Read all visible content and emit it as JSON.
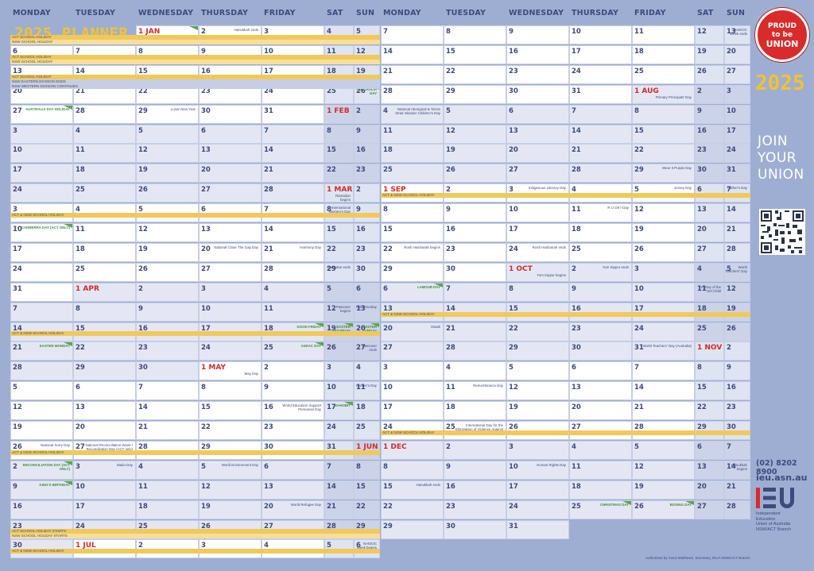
{
  "title": "2025 PLANNER",
  "days_left": [
    "MONDAY",
    "TUESDAY",
    "WEDNESDAY",
    "THURSDAY",
    "FRIDAY",
    "SAT",
    "SUN"
  ],
  "days_right": [
    "MONDAY",
    "TUESDAY",
    "WEDNESDAY",
    "THURSDAY",
    "FRIDAY",
    "SAT",
    "SUN"
  ],
  "months": {
    "1": "JAN",
    "2": "FEB",
    "3": "MAR",
    "4": "APR",
    "5": "MAY",
    "6": "JUN",
    "7": "JUL",
    "8": "AUG",
    "9": "SEP",
    "10": "OCT",
    "11": "NOV",
    "12": "DEC"
  },
  "events": {
    "2025-01-01": "NEW YEAR'S DAY",
    "2025-01-02": "Hanukkah ends",
    "2025-01-26": "AUSTRALIA DAY",
    "2025-01-27": "AUSTRALIA DAY HOLIDAY",
    "2025-01-29": "Lunar New Year",
    "2025-03-01": "Ramadan begins",
    "2025-03-08": "International Women's Day",
    "2025-03-10": "CANBERRA DAY (ACT ONLY)",
    "2025-03-21": "Harmony Day",
    "2025-03-20": "National Close The Gap Day",
    "2025-03-29": "Ramadan ends",
    "2025-04-12": "Passover begins",
    "2025-04-13": "Palm Sunday",
    "2025-04-18": "GOOD FRIDAY",
    "2025-04-19": "EASTER SATURDAY",
    "2025-04-20": "EASTER SUNDAY",
    "2025-04-21": "EASTER MONDAY",
    "2025-04-25": "ANZAC DAY",
    "2025-04-27": "Passover ends",
    "2025-05-01": "May Day",
    "2025-05-11": "Mother's Day",
    "2025-05-17": "IDAHOBIT",
    "2025-05-16": "World Education Support Personnel Day",
    "2025-05-26": "National Sorry Day",
    "2025-05-27": "National Reconciliation Week / Reconciliation Day (ACT only)",
    "2025-06-02": "RECONCILIATION DAY (ACT ONLY)",
    "2025-06-03": "Mabo Day",
    "2025-06-05": "World Environment Day",
    "2025-06-09": "KING'S BIRTHDAY",
    "2025-06-20": "World Refugee Day",
    "2025-07-06": "NAIDOC Week begins",
    "2025-07-13": "NAIDOC Week ends",
    "2025-08-01": "Primary Principals' Day",
    "2025-08-04": "National Aboriginal & Torres Strait Islander Children's Day",
    "2025-08-29": "Wear It Purple Day",
    "2025-09-03": "Indigenous Literacy Day",
    "2025-09-05": "Jersey Day",
    "2025-09-07": "Father's Day",
    "2025-09-11": "R U OK? Day",
    "2025-09-22": "Rosh Hashanah begins",
    "2025-09-24": "Rosh Hashanah ends",
    "2025-10-01": "Yom Kippur begins",
    "2025-10-02": "Yom Kippur ends",
    "2025-10-05": "World Teachers' Day",
    "2025-10-06": "LABOUR DAY",
    "2025-10-11": "Int'l Day of the Girl Child",
    "2025-10-20": "Diwali",
    "2025-10-31": "World Teachers' Day (Australia)",
    "2025-11-11": "Remembrance Day",
    "2025-11-25": "International Day for the Elimination of Violence Against Women",
    "2025-12-10": "Human Rights Day",
    "2025-12-14": "Hanukkah begins",
    "2025-12-15": "Hanukkah ends",
    "2025-12-25": "CHRISTMAS DAY",
    "2025-12-26": "BOXING DAY"
  },
  "bands": [
    {
      "text": "ACT SCHOOL HOLIDAY",
      "row": 0,
      "right": false
    },
    {
      "text": "NSW SCHOOL HOLIDAY",
      "row": 0,
      "right": false
    },
    {
      "text": "ACT SCHOOL HOLIDAY",
      "row": 1,
      "right": false
    },
    {
      "text": "NSW SCHOOL HOLIDAY",
      "row": 1,
      "right": false
    },
    {
      "text": "ACT SCHOOL HOLIDAY",
      "row": 2,
      "right": false
    },
    {
      "text": "NSW EASTERN DIVISION ENDS",
      "row": 2,
      "right": false
    },
    {
      "text": "NSW WESTERN DIVISION CONTINUES",
      "row": 2,
      "right": false
    },
    {
      "text": "ACT & NSW SCHOOL HOLIDAY",
      "row": 8,
      "right": true
    },
    {
      "text": "ACT & NSW SCHOOL HOLIDAY",
      "row": 9,
      "right": false
    },
    {
      "text": "ACT & NSW SCHOOL HOLIDAY",
      "row": 14,
      "right": true
    },
    {
      "text": "ACT & NSW SCHOOL HOLIDAY",
      "row": 15,
      "right": false
    },
    {
      "text": "ACT & NSW SCHOOL HOLIDAY",
      "row": 20,
      "right": true
    },
    {
      "text": "ACT & NSW SCHOOL HOLIDAY",
      "row": 21,
      "right": false
    },
    {
      "text": "ACT SCHOOL HOLIDAY STARTS",
      "row": 25,
      "right": false
    },
    {
      "text": "NSW SCHOOL HOLIDAY STARTS",
      "row": 25,
      "right": false
    },
    {
      "text": "ACT & NSW SCHOOL HOLIDAY",
      "row": 26,
      "right": false
    }
  ],
  "sidebar": {
    "badge_l1": "PROUD",
    "badge_l2": "to be",
    "badge_l3": "UNION",
    "year": "2025",
    "join_1": "JOIN",
    "join_2": "YOUR",
    "join_3": "UNION",
    "phone": "(02) 8202 8900",
    "web": "ieu.asn.au",
    "ieu_logo": "IEU",
    "org_1": "Independent",
    "org_2": "Education",
    "org_3": "Union of Australia",
    "org_4": "NSW/ACT Branch"
  },
  "authorised": "Authorised by Carol Matthews, Secretary, IEUA NSW/ACT Branch",
  "colors": {
    "background": "#9eaed3",
    "band": "#f1c95a",
    "title": "#f1c232",
    "badge": "#d92b2b",
    "month": "#d22b2b",
    "holiday_flag": "#5aa84a"
  }
}
